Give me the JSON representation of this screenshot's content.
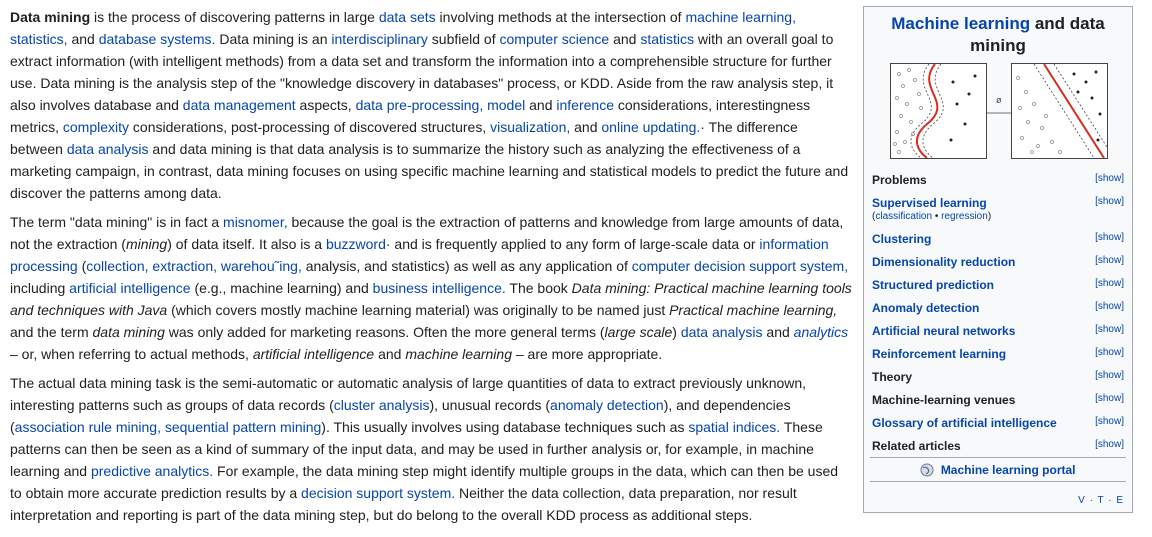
{
  "article": {
    "p1": [
      {
        "t": "Data mining",
        "b": true
      },
      {
        "t": " is the process of discovering patterns in large "
      },
      {
        "t": "data sets",
        "l": true
      },
      {
        "t": " involving methods at the intersection of "
      },
      {
        "t": "machine learning,",
        "l": true
      },
      {
        "t": " "
      },
      {
        "t": "statistics,",
        "l": true
      },
      {
        "t": " and "
      },
      {
        "t": "database systems.",
        "l": true
      },
      {
        "t": "     Data mining is an "
      },
      {
        "t": "interdisciplinary",
        "l": true
      },
      {
        "t": " subfield of "
      },
      {
        "t": "computer science",
        "l": true
      },
      {
        "t": " and "
      },
      {
        "t": "statistics",
        "l": true
      },
      {
        "t": " with an overall goal to extract information (with intelligent methods) from a data set and transform the information into a comprehensible structure for further use.                Data mining is the analysis step of the \"knowledge discovery in databases\" process, or KDD.     Aside from the raw analysis step, it also involves database and "
      },
      {
        "t": "data management",
        "l": true
      },
      {
        "t": " aspects, "
      },
      {
        "t": "data pre-processing,",
        "l": true
      },
      {
        "t": " "
      },
      {
        "t": "model",
        "l": true
      },
      {
        "t": " and "
      },
      {
        "t": "inference",
        "l": true
      },
      {
        "t": " considerations, interestingness metrics, "
      },
      {
        "t": "complexity",
        "l": true
      },
      {
        "t": " considerations, post-processing of discovered structures, "
      },
      {
        "t": "visualization,",
        "l": true
      },
      {
        "t": " and "
      },
      {
        "t": "online updating.",
        "l": true
      },
      {
        "t": "·   The difference between "
      },
      {
        "t": "data analysis",
        "l": true
      },
      {
        "t": " and data mining is that data analysis is to summarize the history such as analyzing the effectiveness of a marketing campaign, in contrast, data mining focuses on using specific machine learning and statistical models to predict the future and discover the patterns among data."
      }
    ],
    "p2": [
      {
        "t": "The term \"data mining\" is in fact a "
      },
      {
        "t": "misnomer,",
        "l": true
      },
      {
        "t": " because the goal is the extraction of patterns and knowledge from large amounts of data, not the extraction ("
      },
      {
        "t": "mining",
        "i": true
      },
      {
        "t": ") of data itself.    It also is a "
      },
      {
        "t": "buzzword",
        "l": true
      },
      {
        "t": "·   and is frequently applied to any form of large-scale data or "
      },
      {
        "t": "information processing",
        "l": true
      },
      {
        "t": " ("
      },
      {
        "t": "collection,",
        "l": true
      },
      {
        "t": " "
      },
      {
        "t": "extraction,",
        "l": true
      },
      {
        "t": " "
      },
      {
        "t": "warehou˜ing,",
        "l": true
      },
      {
        "t": " analysis, and statistics) as well as any application of "
      },
      {
        "t": "computer decision support system,",
        "l": true
      },
      {
        "t": " including "
      },
      {
        "t": "artificial intelligence",
        "l": true
      },
      {
        "t": " (e.g., machine learning) and "
      },
      {
        "t": "business intelligence.",
        "l": true
      },
      {
        "t": " The book "
      },
      {
        "t": "Data mining: Practical machine learning tools and techniques with Java",
        "i": true
      },
      {
        "t": "     (which covers mostly machine learning material) was originally to be named just "
      },
      {
        "t": "Practical machine learning,",
        "i": true
      },
      {
        "t": " and the term "
      },
      {
        "t": "data mining",
        "i": true
      },
      {
        "t": " was only added for marketing reasons.       Often the more general terms ("
      },
      {
        "t": "large scale",
        "i": true
      },
      {
        "t": ") "
      },
      {
        "t": "data analysis",
        "l": true
      },
      {
        "t": " and "
      },
      {
        "t": "analytics",
        "l": true,
        "i": true
      },
      {
        "t": " – or, when referring to actual methods, "
      },
      {
        "t": "artificial intelligence",
        "i": true
      },
      {
        "t": " and "
      },
      {
        "t": "machine learning",
        "i": true
      },
      {
        "t": " – are more appropriate."
      }
    ],
    "p3": [
      {
        "t": "The actual data mining task is the semi-automatic or automatic analysis of large quantities of data to extract previously unknown, interesting patterns such as groups of data records ("
      },
      {
        "t": "cluster analysis",
        "l": true
      },
      {
        "t": "), unusual records ("
      },
      {
        "t": "anomaly detection",
        "l": true
      },
      {
        "t": "), and dependencies ("
      },
      {
        "t": "association rule mining,",
        "l": true
      },
      {
        "t": " "
      },
      {
        "t": "sequential pattern mining",
        "l": true
      },
      {
        "t": "). This usually involves using database techniques such as "
      },
      {
        "t": "spatial indices.",
        "l": true
      },
      {
        "t": " These patterns can then be seen as a kind of summary of the input data, and may be used in further analysis or, for example, in machine learning and "
      },
      {
        "t": "predictive analytics.",
        "l": true
      },
      {
        "t": " For example, the data mining step might identify multiple groups in the data, which can then be used to obtain more accurate prediction results by a "
      },
      {
        "t": "decision support system.",
        "l": true
      },
      {
        "t": " Neither the data collection, data preparation, nor result interpretation and reporting is part of the data mining step, but do belong to the overall KDD process as additional steps."
      }
    ]
  },
  "infobox": {
    "title_link": "Machine learning",
    "title_rest": " and data mining",
    "figure_arrow_label": "ø",
    "show_label": "[show]",
    "rows": [
      {
        "label": "Problems",
        "link": false
      },
      {
        "label": "Supervised learning",
        "link": true,
        "sub_a": "classification",
        "sub_sep": " • ",
        "sub_b": "regression"
      },
      {
        "label": "Clustering",
        "link": true
      },
      {
        "label": "Dimensionality reduction",
        "link": true
      },
      {
        "label": "Structured prediction",
        "link": true
      },
      {
        "label": "Anomaly detection",
        "link": true
      },
      {
        "label": "Artificial neural networks",
        "link": true
      },
      {
        "label": "Reinforcement learning",
        "link": true
      },
      {
        "label": "Theory",
        "link": false
      },
      {
        "label": "Machine-learning venues",
        "link": false
      },
      {
        "label": "Glossary of artificial intelligence",
        "link": true
      },
      {
        "label": "Related articles",
        "link": false
      }
    ],
    "portal_label": "Machine learning portal",
    "vte": "V · T · E"
  }
}
